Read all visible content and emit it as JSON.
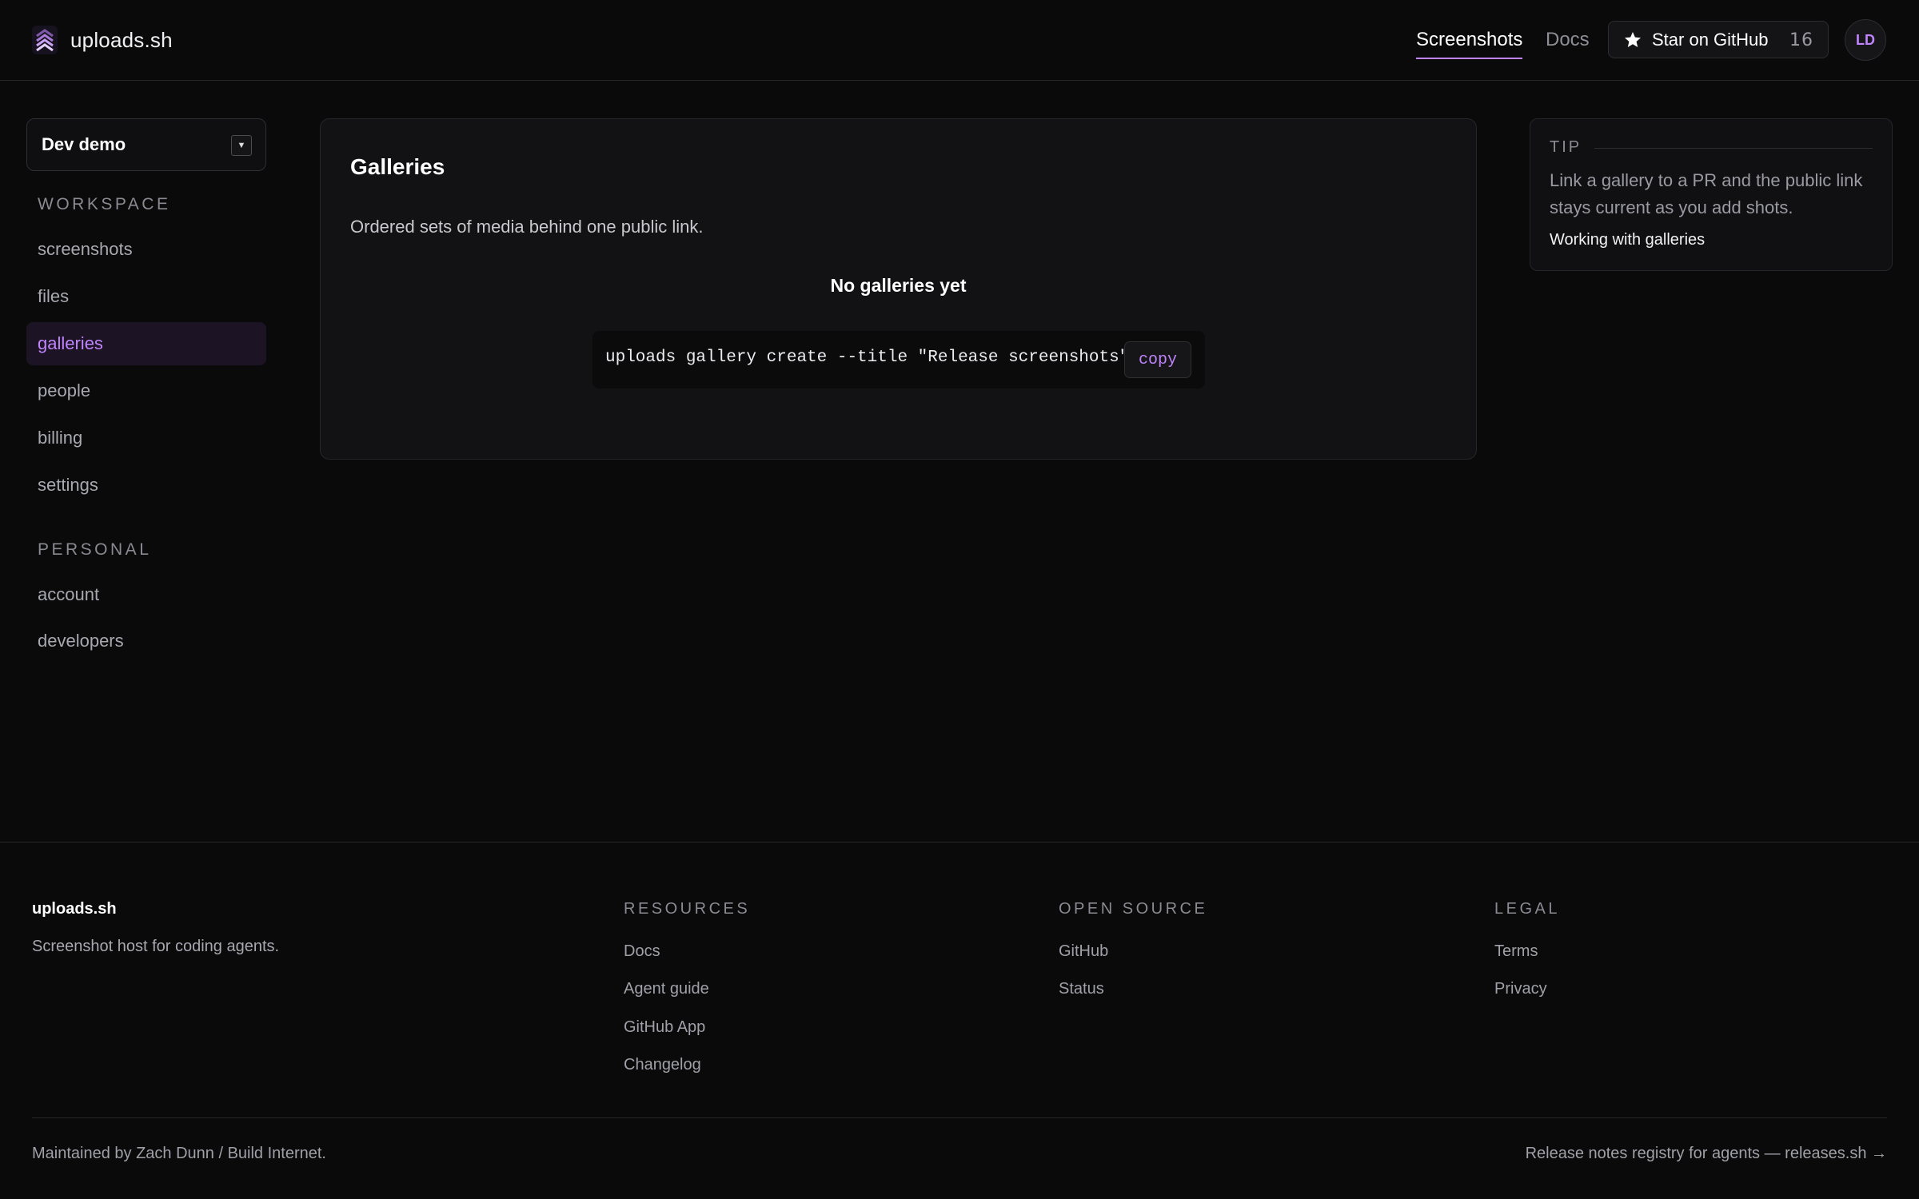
{
  "header": {
    "brand": "uploads.sh",
    "nav": {
      "screenshots": "Screenshots",
      "docs": "Docs"
    },
    "github": {
      "label": "Star on GitHub",
      "count": "16",
      "icon": "star-icon"
    },
    "avatar_initials": "LD",
    "accent_color": "#c084fc"
  },
  "sidebar": {
    "workspace_select": "Dev demo",
    "sections": {
      "workspace": "WORKSPACE",
      "personal": "PERSONAL"
    },
    "workspace_items": [
      {
        "label": "screenshots"
      },
      {
        "label": "files"
      },
      {
        "label": "galleries",
        "active": true
      },
      {
        "label": "people"
      },
      {
        "label": "billing"
      },
      {
        "label": "settings"
      }
    ],
    "personal_items": [
      {
        "label": "account"
      },
      {
        "label": "developers"
      }
    ]
  },
  "main": {
    "title": "Galleries",
    "description": "Ordered sets of media behind one public link.",
    "empty_title": "No galleries yet",
    "command": "uploads gallery create --title \"Release screenshots\"",
    "copy_label": "copy"
  },
  "tip": {
    "label": "TIP",
    "text": "Link a gallery to a PR and the public link stays current as you add shots.",
    "link": "Working with galleries"
  },
  "footer": {
    "brand": "uploads.sh",
    "tagline": "Screenshot host for coding agents.",
    "resources": {
      "title": "RESOURCES",
      "links": [
        "Docs",
        "Agent guide",
        "GitHub App",
        "Changelog"
      ]
    },
    "open_source": {
      "title": "OPEN SOURCE",
      "links": [
        "GitHub",
        "Status"
      ]
    },
    "legal": {
      "title": "LEGAL",
      "links": [
        "Terms",
        "Privacy"
      ]
    },
    "maintained": "Maintained by Zach Dunn / Build Internet.",
    "release_link": "Release notes registry for agents — releases.sh →"
  }
}
